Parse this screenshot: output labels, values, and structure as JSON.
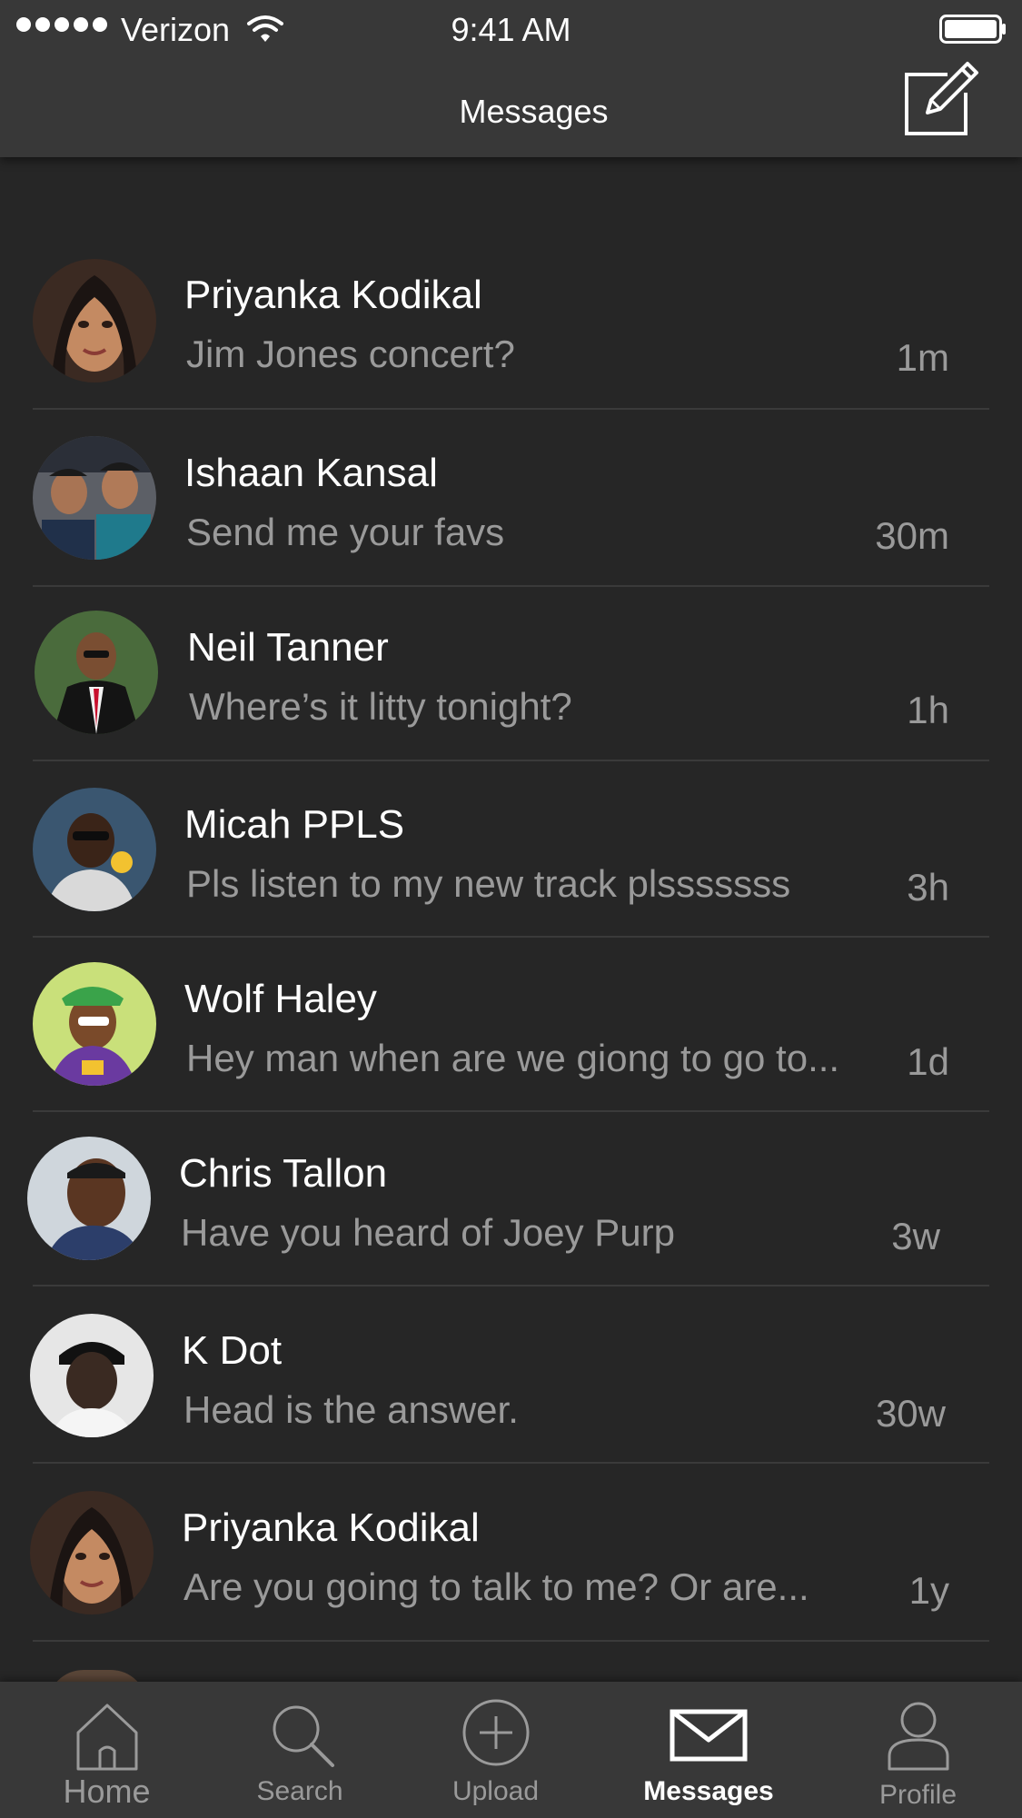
{
  "status_bar": {
    "carrier": "Verizon",
    "time": "9:41 AM"
  },
  "nav": {
    "title": "Messages"
  },
  "conversations": [
    {
      "name": "Priyanka Kodikal",
      "preview": "Jim Jones concert?",
      "time": "1m"
    },
    {
      "name": "Ishaan Kansal",
      "preview": "Send me your favs",
      "time": "30m"
    },
    {
      "name": "Neil Tanner",
      "preview": "Where’s it litty tonight?",
      "time": "1h"
    },
    {
      "name": "Micah PPLS",
      "preview": "Pls listen to my new track plsssssss",
      "time": "3h"
    },
    {
      "name": "Wolf Haley",
      "preview": "Hey man when are we giong to go to...",
      "time": "1d"
    },
    {
      "name": "Chris Tallon",
      "preview": "Have you heard of Joey Purp",
      "time": "3w"
    },
    {
      "name": "K Dot",
      "preview": "Head is the answer.",
      "time": "30w"
    },
    {
      "name": "Priyanka Kodikal",
      "preview": "Are you going to talk to me? Or are...",
      "time": "1y"
    }
  ],
  "tabs": [
    {
      "label": "Home",
      "icon": "home-icon"
    },
    {
      "label": "Search",
      "icon": "search-icon"
    },
    {
      "label": "Upload",
      "icon": "upload-icon"
    },
    {
      "label": "Messages",
      "icon": "mail-icon"
    },
    {
      "label": "Profile",
      "icon": "profile-icon"
    }
  ],
  "colors": {
    "background": "#262626",
    "bar": "#383838",
    "primary_text": "#ffffff",
    "secondary_text": "#9a9a9a"
  }
}
